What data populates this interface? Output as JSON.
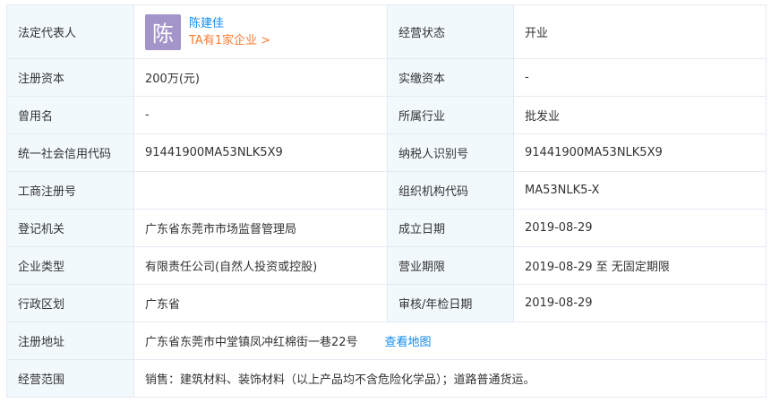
{
  "legal": {
    "label": "法定代表人",
    "avatar_char": "陈",
    "name": "陈建佳",
    "companies_link": "TA有1家企业 >"
  },
  "status": {
    "label": "经营状态",
    "value": "开业"
  },
  "rows": {
    "reg_capital": {
      "label": "注册资本",
      "value": "200万(元)"
    },
    "paid_capital": {
      "label": "实缴资本",
      "value": "-"
    },
    "former_name": {
      "label": "曾用名",
      "value": "-"
    },
    "industry": {
      "label": "所属行业",
      "value": "批发业"
    },
    "credit_code": {
      "label": "统一社会信用代码",
      "value": "91441900MA53NLK5X9"
    },
    "taxpayer_id": {
      "label": "纳税人识别号",
      "value": "91441900MA53NLK5X9"
    },
    "biz_reg_no": {
      "label": "工商注册号",
      "value": ""
    },
    "org_code": {
      "label": "组织机构代码",
      "value": "MA53NLK5-X"
    },
    "authority": {
      "label": "登记机关",
      "value": "广东省东莞市市场监督管理局"
    },
    "founded": {
      "label": "成立日期",
      "value": "2019-08-29"
    },
    "company_type": {
      "label": "企业类型",
      "value": "有限责任公司(自然人投资或控股)"
    },
    "biz_term": {
      "label": "营业期限",
      "value": "2019-08-29 至 无固定期限"
    },
    "region": {
      "label": "行政区划",
      "value": "广东省"
    },
    "inspection": {
      "label": "审核/年检日期",
      "value": "2019-08-29"
    },
    "address": {
      "label": "注册地址",
      "value": "广东省东莞市中堂镇凤冲红棉街一巷22号",
      "map_link": "查看地图"
    },
    "scope": {
      "label": "经营范围",
      "value": "销售：建筑材料、装饰材料（以上产品均不含危险化学品）；道路普通货运。"
    }
  },
  "colors": {
    "label_bg": "#f2f9fc",
    "border": "#e4eaf2",
    "link_blue": "#128bed",
    "link_orange": "#fd7b30",
    "avatar_bg": "#a395c9"
  }
}
